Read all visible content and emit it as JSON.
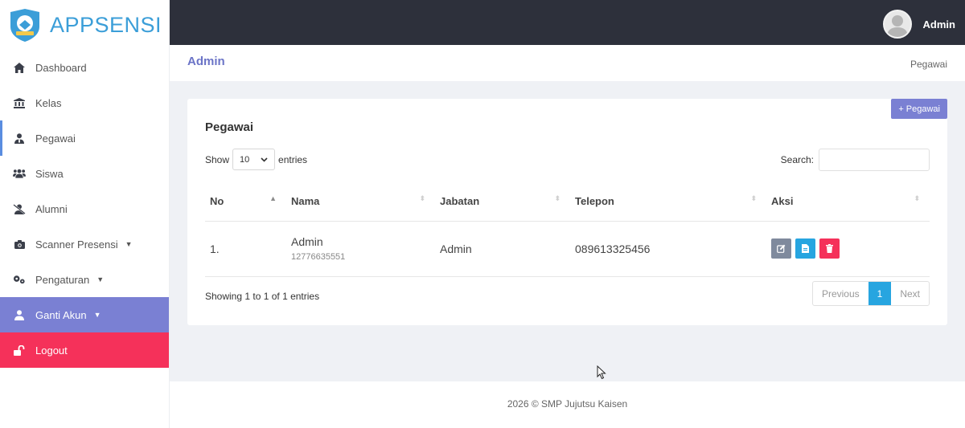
{
  "brand": {
    "name": "APPSENSI"
  },
  "sidebar": {
    "items": [
      {
        "label": "Dashboard",
        "icon": "home-icon"
      },
      {
        "label": "Kelas",
        "icon": "bank-icon"
      },
      {
        "label": "Pegawai",
        "icon": "user-tie-icon",
        "active": true
      },
      {
        "label": "Siswa",
        "icon": "users-icon"
      },
      {
        "label": "Alumni",
        "icon": "user-slash-icon"
      },
      {
        "label": "Scanner Presensi",
        "icon": "camera-icon",
        "dropdown": true
      },
      {
        "label": "Pengaturan",
        "icon": "cogs-icon",
        "dropdown": true
      },
      {
        "label": "Ganti Akun",
        "icon": "user-icon",
        "dropdown": true
      },
      {
        "label": "Logout",
        "icon": "unlock-icon"
      }
    ]
  },
  "topbar": {
    "user_name": "Admin"
  },
  "header": {
    "title": "Admin",
    "breadcrumb": "Pegawai"
  },
  "card": {
    "title": "Pegawai",
    "add_button": "+ Pegawai",
    "show_label": "Show",
    "entries_value": "10",
    "entries_label": "entries",
    "search_label": "Search:",
    "search_value": ""
  },
  "table": {
    "columns": [
      "No",
      "Nama",
      "Jabatan",
      "Telepon",
      "Aksi"
    ],
    "rows": [
      {
        "no": "1.",
        "nama": "Admin",
        "nip": "12776635551",
        "jabatan": "Admin",
        "telepon": "089613325456"
      }
    ]
  },
  "pagination": {
    "info": "Showing 1 to 1 of 1 entries",
    "previous": "Previous",
    "current": "1",
    "next": "Next"
  },
  "footer": {
    "text": "2026 © SMP Jujutsu Kaisen"
  },
  "colors": {
    "topbar": "#2d303b",
    "accent": "#7a80d3",
    "danger": "#f5315a",
    "info": "#27a5e0",
    "brand": "#3b9ed8"
  }
}
